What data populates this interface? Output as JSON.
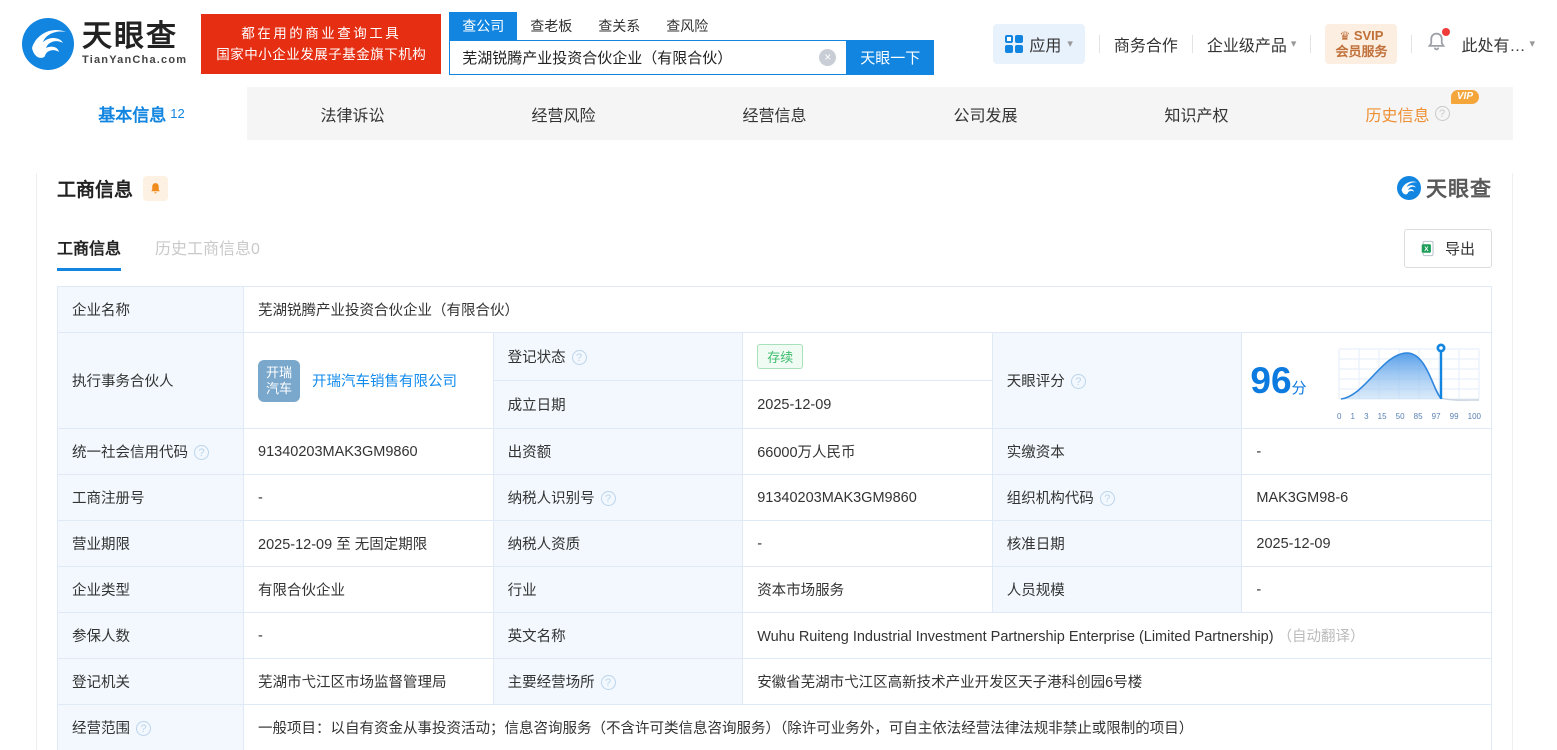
{
  "icons": {
    "caret_down": "▾",
    "help": "?",
    "close": "×",
    "crown": "♛"
  },
  "header": {
    "logo_cn": "天眼查",
    "logo_en": "TianYanCha.com",
    "banner_line1": "都在用的商业查询工具",
    "banner_line2": "国家中小企业发展子基金旗下机构",
    "search_tabs": [
      {
        "label": "查公司"
      },
      {
        "label": "查老板"
      },
      {
        "label": "查关系"
      },
      {
        "label": "查风险"
      }
    ],
    "search_value": "芜湖锐腾产业投资合伙企业（有限合伙）",
    "search_button": "天眼一下",
    "nav_apps": "应用",
    "nav_biz": "商务合作",
    "nav_enterprise": "企业级产品",
    "svip_line1": "SVIP",
    "svip_line2": "会员服务",
    "nav_user": "此处有…"
  },
  "tabs": [
    {
      "label": "基本信息",
      "count": "12"
    },
    {
      "label": "法律诉讼"
    },
    {
      "label": "经营风险"
    },
    {
      "label": "经营信息"
    },
    {
      "label": "公司发展"
    },
    {
      "label": "知识产权"
    },
    {
      "label": "历史信息",
      "vip_badge": "VIP"
    }
  ],
  "section": {
    "title": "工商信息",
    "watermark": "天眼查",
    "subtab_current": "工商信息",
    "subtab_history": "历史工商信息0",
    "export_label": "导出"
  },
  "fields": {
    "company_name": {
      "label": "企业名称",
      "value": "芜湖锐腾产业投资合伙企业（有限合伙）"
    },
    "partner": {
      "label": "执行事务合伙人",
      "link": "开瑞汽车销售有限公司",
      "logo_line1": "开瑞",
      "logo_line2": "汽车"
    },
    "reg_status": {
      "label": "登记状态",
      "value": "存续"
    },
    "est_date": {
      "label": "成立日期",
      "value": "2025-12-09"
    },
    "score": {
      "label": "天眼评分",
      "value": "96",
      "unit": "分",
      "axis": [
        "0",
        "1",
        "3",
        "15",
        "50",
        "85",
        "97",
        "99",
        "100"
      ]
    },
    "credit_code": {
      "label": "统一社会信用代码",
      "value": "91340203MAK3GM9860"
    },
    "capital": {
      "label": "出资额",
      "value": "66000万人民币"
    },
    "paid_capital": {
      "label": "实缴资本",
      "value": "-"
    },
    "reg_number": {
      "label": "工商注册号",
      "value": "-"
    },
    "taxpayer_id": {
      "label": "纳税人识别号",
      "value": "91340203MAK3GM9860"
    },
    "org_code": {
      "label": "组织机构代码",
      "value": "MAK3GM98-6"
    },
    "business_term": {
      "label": "营业期限",
      "value": "2025-12-09 至 无固定期限"
    },
    "taxpayer_quality": {
      "label": "纳税人资质",
      "value": "-"
    },
    "approval_date": {
      "label": "核准日期",
      "value": "2025-12-09"
    },
    "company_type": {
      "label": "企业类型",
      "value": "有限合伙企业"
    },
    "industry": {
      "label": "行业",
      "value": "资本市场服务"
    },
    "staff_size": {
      "label": "人员规模",
      "value": "-"
    },
    "insured_count": {
      "label": "参保人数",
      "value": "-"
    },
    "english_name": {
      "label": "英文名称",
      "value": "Wuhu Ruiteng Industrial Investment Partnership Enterprise (Limited Partnership)",
      "suffix": "（自动翻译）"
    },
    "reg_authority": {
      "label": "登记机关",
      "value": "芜湖市弋江区市场监督管理局"
    },
    "business_place": {
      "label": "主要经营场所",
      "value": "安徽省芜湖市弋江区高新技术产业开发区天子港科创园6号楼"
    },
    "business_scope": {
      "label": "经营范围",
      "value": "一般项目：以自有资金从事投资活动；信息咨询服务（不含许可类信息咨询服务）（除许可业务外，可自主依法经营法律法规非禁止或限制的项目）"
    }
  }
}
